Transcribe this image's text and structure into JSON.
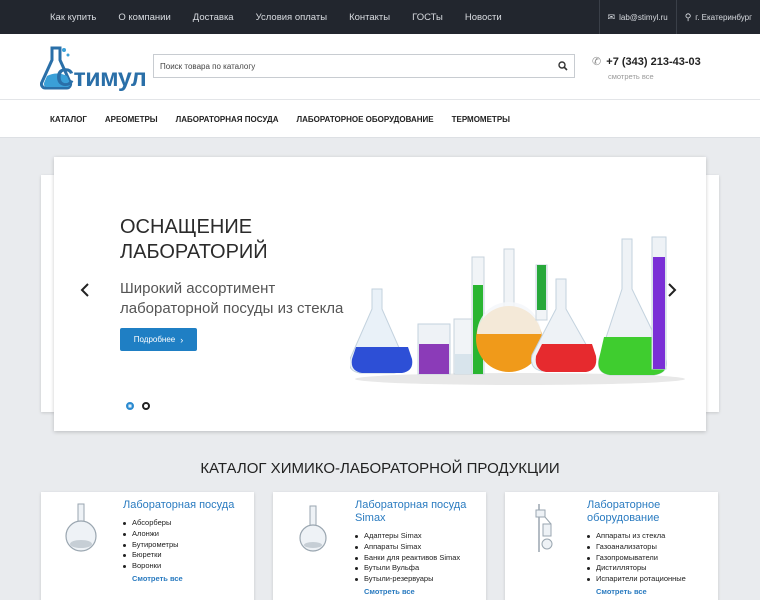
{
  "topbar": {
    "links": [
      "Как купить",
      "О компании",
      "Доставка",
      "Условия оплаты",
      "Контакты",
      "ГОСТы",
      "Новости"
    ],
    "email": "lab@stimyl.ru",
    "city": "г. Екатеринбург"
  },
  "header": {
    "logo_text": "Стимул",
    "search_placeholder": "Поиск товара по каталогу",
    "phone": "+7 (343) 213-43-03",
    "see_all": "смотреть все"
  },
  "menu": [
    "КАТАЛОГ",
    "АРЕОМЕТРЫ",
    "ЛАБОРАТОРНАЯ ПОСУДА",
    "ЛАБОРАТОРНОЕ ОБОРУДОВАНИЕ",
    "ТЕРМОМЕТРЫ"
  ],
  "slider": {
    "title_line1": "ОСНАЩЕНИЕ",
    "title_line2": "ЛАБОРАТОРИЙ",
    "subtitle_line1": "Широкий ассортимент",
    "subtitle_line2": "лабораторной посуды из стекла",
    "button": "Подробнее",
    "slide_count": 2,
    "active_slide": 1
  },
  "catalog": {
    "title": "КАТАЛОГ ХИМИКО-ЛАБОРАТОРНОЙ ПРОДУКЦИИ",
    "more_label": "Смотреть все",
    "cards": [
      {
        "title_line1": "Лабораторная посуда",
        "title_line2": "",
        "items": [
          "Абсорберы",
          "Алонжи",
          "Бутирометры",
          "Бюретки",
          "Воронки"
        ]
      },
      {
        "title_line1": "Лабораторная посуда",
        "title_line2": "Simax",
        "items": [
          "Адаптеры Simax",
          "Аппараты Simax",
          "Банки для реактивов Simax",
          "Бутыли Вульфа",
          "Бутыли-резервуары"
        ]
      },
      {
        "title_line1": "Лабораторное",
        "title_line2": "оборудование",
        "items": [
          "Аппараты из стекла",
          "Газоанализаторы",
          "Газопромыватели",
          "Дистилляторы",
          "Испарители ротационные"
        ]
      }
    ]
  },
  "colors": {
    "topbar": "#22262e",
    "accent_blue": "#1f7fc4",
    "link_blue": "#2a7bc0",
    "page_bg": "#e9ebee"
  },
  "icons": {
    "email": "envelope-icon",
    "city": "map-pin-icon",
    "search": "search-icon",
    "phone": "phone-icon",
    "prev": "chevron-left-icon",
    "next": "chevron-right-icon",
    "button_arrow": "chevron-right-icon"
  }
}
